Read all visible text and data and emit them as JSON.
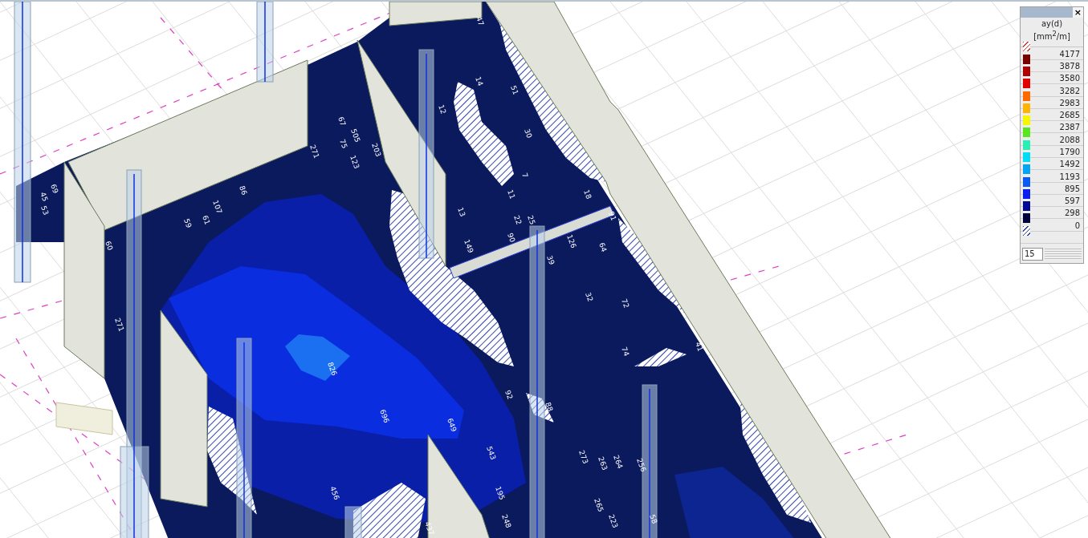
{
  "legend": {
    "title": "ay(d)",
    "unit": "[mm$^{2}$/m]",
    "close": "×",
    "steps": "15",
    "entries": [
      {
        "kind": "hatch",
        "color": "#d04040",
        "value": "4177"
      },
      {
        "kind": "solid",
        "color": "#7a0000",
        "value": "3878"
      },
      {
        "kind": "solid",
        "color": "#b00000",
        "value": "3580"
      },
      {
        "kind": "solid",
        "color": "#e00000",
        "value": "3282"
      },
      {
        "kind": "solid",
        "color": "#ff6a00",
        "value": "2983"
      },
      {
        "kind": "solid",
        "color": "#ffb400",
        "value": "2685"
      },
      {
        "kind": "solid",
        "color": "#f6f600",
        "value": "2387"
      },
      {
        "kind": "solid",
        "color": "#5ae61e",
        "value": "2088"
      },
      {
        "kind": "solid",
        "color": "#28f0b4",
        "value": "1790"
      },
      {
        "kind": "solid",
        "color": "#00dcf5",
        "value": "1492"
      },
      {
        "kind": "solid",
        "color": "#00a5f5",
        "value": "1193"
      },
      {
        "kind": "solid",
        "color": "#0a5af5",
        "value": "895"
      },
      {
        "kind": "solid",
        "color": "#0a1ef0",
        "value": "597"
      },
      {
        "kind": "solid",
        "color": "#000a96",
        "value": "298"
      },
      {
        "kind": "solid",
        "color": "#00003c",
        "value": "0"
      },
      {
        "kind": "hatch",
        "color": "#3040b0"
      }
    ]
  },
  "value_labels": [
    "47",
    "14",
    "51",
    "30",
    "7",
    "11",
    "18",
    "13",
    "22",
    "25",
    "90",
    "126",
    "64",
    "39",
    "149",
    "12",
    "67",
    "505",
    "75",
    "123",
    "203",
    "271",
    "86",
    "107",
    "61",
    "59",
    "69",
    "45",
    "53",
    "60",
    "271",
    "32",
    "72",
    "74",
    "41",
    "826",
    "696",
    "649",
    "543",
    "456",
    "92",
    "88",
    "273",
    "263",
    "264",
    "256",
    "195",
    "265",
    "223",
    "248",
    "58",
    "437",
    "91"
  ]
}
